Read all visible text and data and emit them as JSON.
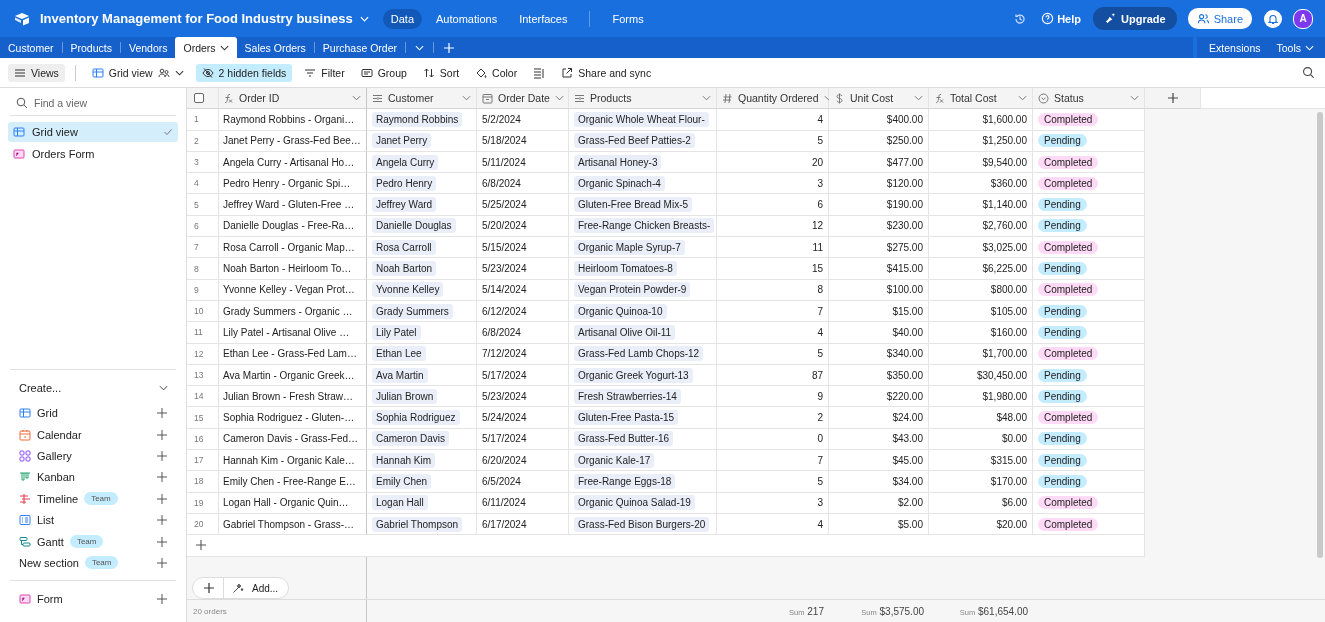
{
  "topbar": {
    "title": "Inventory Management for Food Industry business",
    "nav": [
      {
        "label": "Data",
        "selected": true
      },
      {
        "label": "Automations",
        "selected": false
      },
      {
        "label": "Interfaces",
        "selected": false
      },
      {
        "label": "Forms",
        "selected": false
      }
    ],
    "help": "Help",
    "upgrade": "Upgrade",
    "share": "Share",
    "avatar": "A"
  },
  "tables": [
    {
      "label": "Customer",
      "selected": false
    },
    {
      "label": "Products",
      "selected": false
    },
    {
      "label": "Vendors",
      "selected": false
    },
    {
      "label": "Orders",
      "selected": true
    },
    {
      "label": "Sales Orders",
      "selected": false
    },
    {
      "label": "Purchase Order",
      "selected": false
    }
  ],
  "table_tools": [
    "Extensions",
    "Tools"
  ],
  "toolbar": {
    "views": "Views",
    "view_name": "Grid view",
    "hidden_fields": "2 hidden fields",
    "actions": [
      {
        "label": "Filter",
        "kind": "filter"
      },
      {
        "label": "Group",
        "kind": "group"
      },
      {
        "label": "Sort",
        "kind": "sort"
      },
      {
        "label": "Color",
        "kind": "color"
      }
    ],
    "share_sync": "Share and sync"
  },
  "sidebar": {
    "search_placeholder": "Find a view",
    "views": [
      {
        "label": "Grid view",
        "kind": "grid",
        "selected": true
      },
      {
        "label": "Orders Form",
        "kind": "form",
        "selected": false
      }
    ],
    "create_label": "Create...",
    "create_items": [
      {
        "label": "Grid",
        "kind": "grid"
      },
      {
        "label": "Calendar",
        "kind": "calendar"
      },
      {
        "label": "Gallery",
        "kind": "gallery"
      },
      {
        "label": "Kanban",
        "kind": "kanban"
      },
      {
        "label": "Timeline",
        "kind": "timeline",
        "badge": "Team"
      },
      {
        "label": "List",
        "kind": "list"
      },
      {
        "label": "Gantt",
        "kind": "gantt",
        "badge": "Team"
      },
      {
        "label": "New section",
        "kind": "section",
        "badge": "Team"
      }
    ],
    "form_item": {
      "label": "Form",
      "kind": "form"
    }
  },
  "grid": {
    "select_all": {
      "checked": false
    },
    "columns": [
      {
        "label": "Order ID",
        "kind": "formula"
      },
      {
        "label": "Customer",
        "kind": "link"
      },
      {
        "label": "Order Date",
        "kind": "date"
      },
      {
        "label": "Products",
        "kind": "link"
      },
      {
        "label": "Quantity Ordered",
        "kind": "number"
      },
      {
        "label": "Unit Cost",
        "kind": "currency"
      },
      {
        "label": "Total Cost",
        "kind": "formula"
      },
      {
        "label": "Status",
        "kind": "select"
      }
    ],
    "rows": [
      {
        "num": "1",
        "order_id": "Raymond Robbins - Organi…",
        "customer": "Raymond Robbins",
        "date": "5/2/2024",
        "product": "Organic Whole Wheat Flour-",
        "qty": "4",
        "unit": "$400.00",
        "total": "$1,600.00",
        "status": {
          "label": "Completed",
          "color": "#ffdaf6"
        }
      },
      {
        "num": "2",
        "order_id": "Janet Perry - Grass-Fed Bee…",
        "customer": "Janet Perry",
        "date": "5/18/2024",
        "product": "Grass-Fed Beef Patties-2",
        "qty": "5",
        "unit": "$250.00",
        "total": "$1,250.00",
        "status": {
          "label": "Pending",
          "color": "#c4ecff"
        }
      },
      {
        "num": "3",
        "order_id": "Angela Curry - Artisanal Ho…",
        "customer": "Angela Curry",
        "date": "5/11/2024",
        "product": "Artisanal Honey-3",
        "qty": "20",
        "unit": "$477.00",
        "total": "$9,540.00",
        "status": {
          "label": "Completed",
          "color": "#ffdaf6"
        }
      },
      {
        "num": "4",
        "order_id": "Pedro Henry - Organic Spi…",
        "customer": "Pedro Henry",
        "date": "6/8/2024",
        "product": "Organic Spinach-4",
        "qty": "3",
        "unit": "$120.00",
        "total": "$360.00",
        "status": {
          "label": "Completed",
          "color": "#ffdaf6"
        }
      },
      {
        "num": "5",
        "order_id": "Jeffrey Ward - Gluten-Free …",
        "customer": "Jeffrey Ward",
        "date": "5/25/2024",
        "product": "Gluten-Free Bread Mix-5",
        "qty": "6",
        "unit": "$190.00",
        "total": "$1,140.00",
        "status": {
          "label": "Pending",
          "color": "#c4ecff"
        }
      },
      {
        "num": "6",
        "order_id": "Danielle Douglas - Free-Ra…",
        "customer": "Danielle Douglas",
        "date": "5/20/2024",
        "product": "Free-Range Chicken Breasts-",
        "qty": "12",
        "unit": "$230.00",
        "total": "$2,760.00",
        "status": {
          "label": "Pending",
          "color": "#c4ecff"
        }
      },
      {
        "num": "7",
        "order_id": "Rosa Carroll - Organic Map…",
        "customer": "Rosa Carroll",
        "date": "5/15/2024",
        "product": "Organic Maple Syrup-7",
        "qty": "11",
        "unit": "$275.00",
        "total": "$3,025.00",
        "status": {
          "label": "Completed",
          "color": "#ffdaf6"
        }
      },
      {
        "num": "8",
        "order_id": "Noah Barton - Heirloom To…",
        "customer": "Noah Barton",
        "date": "5/23/2024",
        "product": "Heirloom Tomatoes-8",
        "qty": "15",
        "unit": "$415.00",
        "total": "$6,225.00",
        "status": {
          "label": "Pending",
          "color": "#c4ecff"
        }
      },
      {
        "num": "9",
        "order_id": "Yvonne Kelley - Vegan Prot…",
        "customer": "Yvonne Kelley",
        "date": "5/14/2024",
        "product": "Vegan Protein Powder-9",
        "qty": "8",
        "unit": "$100.00",
        "total": "$800.00",
        "status": {
          "label": "Completed",
          "color": "#ffdaf6"
        }
      },
      {
        "num": "10",
        "order_id": "Grady Summers - Organic …",
        "customer": "Grady Summers",
        "date": "6/12/2024",
        "product": "Organic Quinoa-10",
        "qty": "7",
        "unit": "$15.00",
        "total": "$105.00",
        "status": {
          "label": "Pending",
          "color": "#c4ecff"
        }
      },
      {
        "num": "11",
        "order_id": "Lily Patel - Artisanal Olive …",
        "customer": "Lily Patel",
        "date": "6/8/2024",
        "product": "Artisanal Olive Oil-11",
        "qty": "4",
        "unit": "$40.00",
        "total": "$160.00",
        "status": {
          "label": "Pending",
          "color": "#c4ecff"
        }
      },
      {
        "num": "12",
        "order_id": "Ethan Lee - Grass-Fed Lam…",
        "customer": "Ethan Lee",
        "date": "7/12/2024",
        "product": "Grass-Fed Lamb Chops-12",
        "qty": "5",
        "unit": "$340.00",
        "total": "$1,700.00",
        "status": {
          "label": "Completed",
          "color": "#ffdaf6"
        }
      },
      {
        "num": "13",
        "order_id": "Ava Martin - Organic Greek…",
        "customer": "Ava Martin",
        "date": "5/17/2024",
        "product": "Organic Greek Yogurt-13",
        "qty": "87",
        "unit": "$350.00",
        "total": "$30,450.00",
        "status": {
          "label": "Pending",
          "color": "#c4ecff"
        }
      },
      {
        "num": "14",
        "order_id": "Julian Brown - Fresh Straw…",
        "customer": "Julian Brown",
        "date": "5/23/2024",
        "product": "Fresh Strawberries-14",
        "qty": "9",
        "unit": "$220.00",
        "total": "$1,980.00",
        "status": {
          "label": "Pending",
          "color": "#c4ecff"
        }
      },
      {
        "num": "15",
        "order_id": "Sophia Rodriguez - Gluten-…",
        "customer": "Sophia Rodriguez",
        "date": "5/24/2024",
        "product": "Gluten-Free Pasta-15",
        "qty": "2",
        "unit": "$24.00",
        "total": "$48.00",
        "status": {
          "label": "Completed",
          "color": "#ffdaf6"
        }
      },
      {
        "num": "16",
        "order_id": "Cameron Davis - Grass-Fed…",
        "customer": "Cameron Davis",
        "date": "5/17/2024",
        "product": "Grass-Fed Butter-16",
        "qty": "0",
        "unit": "$43.00",
        "total": "$0.00",
        "status": {
          "label": "Pending",
          "color": "#c4ecff"
        }
      },
      {
        "num": "17",
        "order_id": "Hannah Kim - Organic Kale…",
        "customer": "Hannah Kim",
        "date": "6/20/2024",
        "product": "Organic Kale-17",
        "qty": "7",
        "unit": "$45.00",
        "total": "$315.00",
        "status": {
          "label": "Pending",
          "color": "#c4ecff"
        }
      },
      {
        "num": "18",
        "order_id": "Emily Chen - Free-Range E…",
        "customer": "Emily Chen",
        "date": "6/5/2024",
        "product": "Free-Range Eggs-18",
        "qty": "5",
        "unit": "$34.00",
        "total": "$170.00",
        "status": {
          "label": "Pending",
          "color": "#c4ecff"
        }
      },
      {
        "num": "19",
        "order_id": "Logan Hall - Organic Quin…",
        "customer": "Logan Hall",
        "date": "6/11/2024",
        "product": "Organic Quinoa Salad-19",
        "qty": "3",
        "unit": "$2.00",
        "total": "$6.00",
        "status": {
          "label": "Completed",
          "color": "#ffdaf6"
        }
      },
      {
        "num": "20",
        "order_id": "Gabriel Thompson - Grass-…",
        "customer": "Gabriel Thompson",
        "date": "6/17/2024",
        "product": "Grass-Fed Bison Burgers-20",
        "qty": "4",
        "unit": "$5.00",
        "total": "$20.00",
        "status": {
          "label": "Completed",
          "color": "#ffdaf6"
        }
      }
    ],
    "add_label": "Add...",
    "count": "20 orders",
    "sums": [
      {
        "label": "Sum",
        "value": "217"
      },
      {
        "label": "Sum",
        "value": "$3,575.00"
      },
      {
        "label": "Sum",
        "value": "$61,654.00"
      }
    ]
  }
}
